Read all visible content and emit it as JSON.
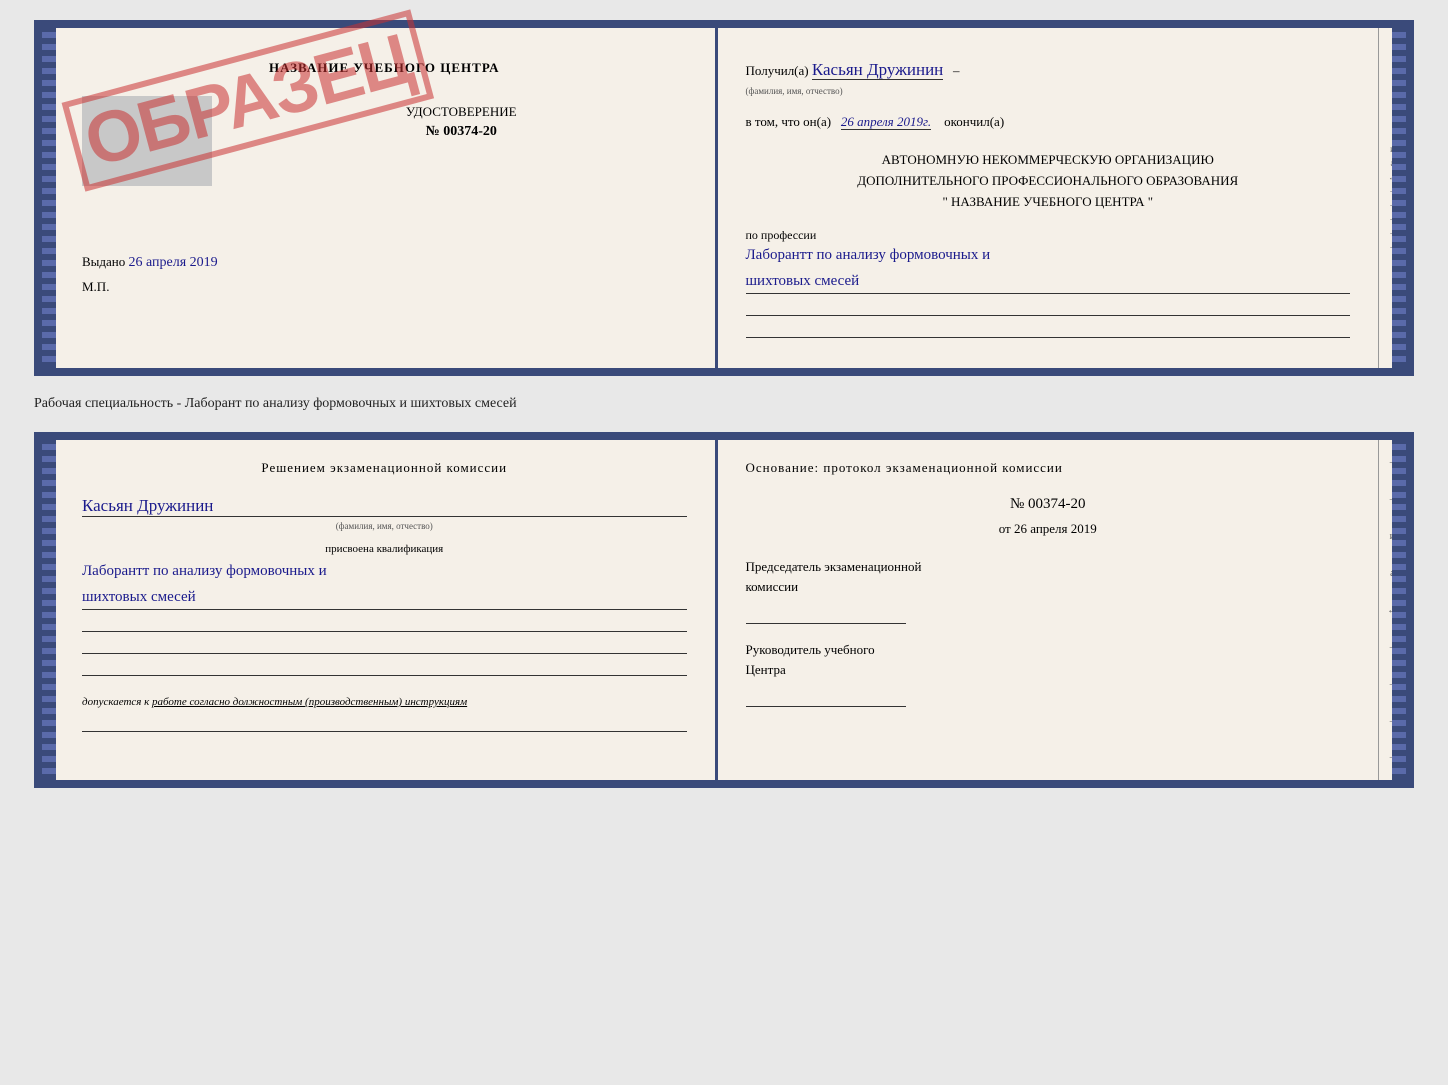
{
  "top_document": {
    "left": {
      "title": "НАЗВАНИЕ УЧЕБНОГО ЦЕНТРА",
      "stamp_text": "ОБРАЗЕЦ",
      "udostoverenie_label": "УДОСТОВЕРЕНИЕ",
      "cert_number": "№ 00374-20",
      "vydano_label": "Выдано",
      "vydano_date": "26 апреля 2019",
      "mp_label": "М.П."
    },
    "right": {
      "poluchil_label": "Получил(a)",
      "recipient_name": "Касьян Дружинин",
      "fio_small": "(фамилия, имя, отчество)",
      "vtom_label": "в том, что он(а)",
      "completed_date": "26 апреля 2019г.",
      "okonchil_label": "окончил(а)",
      "org_line1": "АВТОНОМНУЮ НЕКОММЕРЧЕСКУЮ ОРГАНИЗАЦИЮ",
      "org_line2": "ДОПОЛНИТЕЛЬНОГО ПРОФЕССИОНАЛЬНОГО ОБРАЗОВАНИЯ",
      "org_name": "\"  НАЗВАНИЕ УЧЕБНОГО ЦЕНТРА  \"",
      "po_professii_label": "по профессии",
      "profession_line1": "Лаборантт по анализу формовочных и",
      "profession_line2": "шихтовых смесей"
    }
  },
  "middle_text": "Рабочая специальность - Лаборант по анализу формовочных и шихтовых смесей",
  "bottom_document": {
    "left": {
      "decision_label": "Решением экзаменационной комиссии",
      "name_handwritten": "Касьян Дружинин",
      "fio_small": "(фамилия, имя, отчество)",
      "prisvoena_label": "присвоена квалификация",
      "qualification_line1": "Лаборантт по анализу формовочных и",
      "qualification_line2": "шихтовых смесей",
      "dopuskaetsya_prefix": "допускается к",
      "dopuskaetsya_text": "работе согласно должностным (производственным) инструкциям"
    },
    "right": {
      "osnovanie_label": "Основание: протокол экзаменационной комиссии",
      "protocol_number": "№ 00374-20",
      "ot_label": "от",
      "ot_date": "26 апреля 2019",
      "predsedatel_line1": "Председатель экзаменационной",
      "predsedatel_line2": "комиссии",
      "rukovoditel_line1": "Руководитель учебного",
      "rukovoditel_line2": "Центра"
    }
  },
  "deco": {
    "right_chars": [
      "и",
      "а",
      "←",
      "–",
      "–",
      "–",
      "–",
      "–"
    ]
  }
}
